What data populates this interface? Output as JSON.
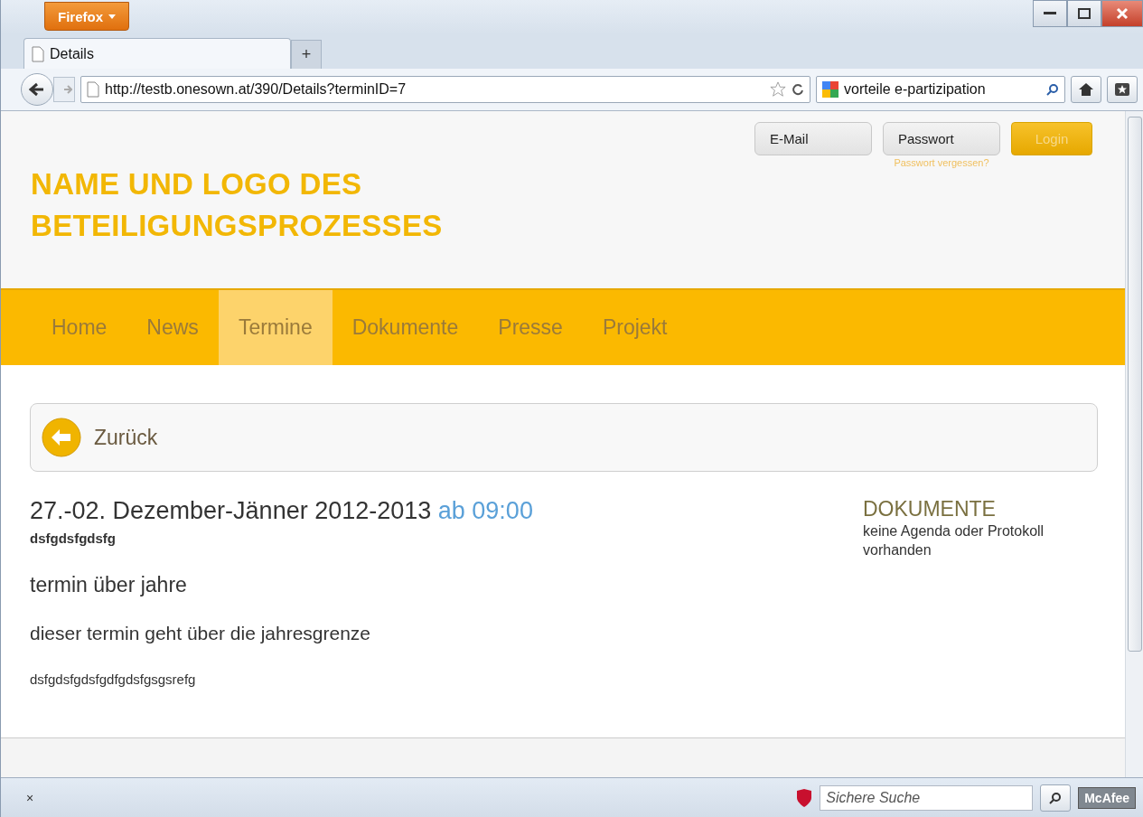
{
  "browser": {
    "menu_button": "Firefox",
    "tabs": [
      {
        "label": "Details",
        "selected": true
      }
    ],
    "new_tab": "+",
    "url": "http://testb.onesown.at/390/Details?terminID=7",
    "search_value": "vorteile e-partizipation"
  },
  "header": {
    "logo_lines": [
      "NAME UND LOGO DES",
      "BETEILIGUNGSPROZESSES"
    ],
    "email_placeholder": "E-Mail",
    "password_placeholder": "Passwort",
    "login": "Login",
    "forgot": "Passwort vergessen?"
  },
  "nav": [
    {
      "label": "Home",
      "selected": false
    },
    {
      "label": "News",
      "selected": false
    },
    {
      "label": "Termine",
      "selected": true
    },
    {
      "label": "Dokumente",
      "selected": false
    },
    {
      "label": "Presse",
      "selected": false
    },
    {
      "label": "Projekt",
      "selected": false
    }
  ],
  "back": "Zurück",
  "event": {
    "date": "27.-02. Dezember-Jänner 2012-2013",
    "time": "ab 09:00",
    "location": "dsfgdsfgdsfg",
    "title": "termin über jahre",
    "subtitle": "dieser termin geht über die jahresgrenze",
    "description": "dsfgdsfgdsfgdfgdsfgsgsrefg"
  },
  "documents": {
    "heading": "DOKUMENTE",
    "text": "keine Agenda oder Protokoll vorhanden"
  },
  "status_bar": {
    "close": "×",
    "search_placeholder": "Sichere Suche",
    "brand": "McAfee"
  }
}
